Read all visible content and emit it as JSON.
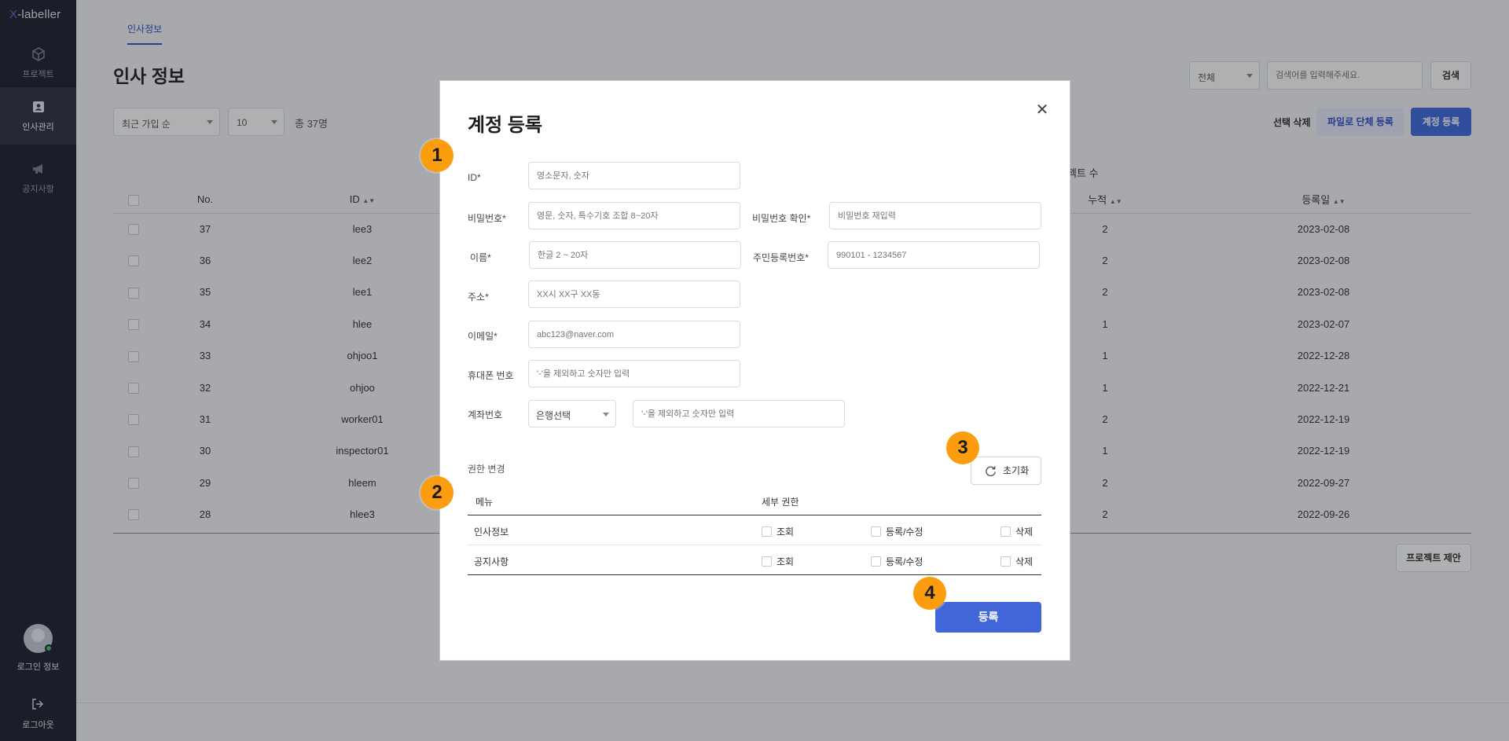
{
  "sidebar": {
    "logo_x": "X",
    "logo_rest": "-labeller",
    "items": [
      {
        "label": "프로젝트",
        "icon": "cube-icon"
      },
      {
        "label": "인사관리",
        "icon": "id-card-icon"
      },
      {
        "label": "공지사항",
        "icon": "megaphone-icon"
      }
    ],
    "login_info": "로그인 정보",
    "logout": "로그아웃"
  },
  "page": {
    "tab": "인사정보",
    "title": "인사 정보",
    "sort_select": "최근 가입 순",
    "page_size": "10",
    "total": "총 37명",
    "filter_select": "전체",
    "search_placeholder": "검색어를 입력해주세요.",
    "search_button": "검색",
    "delete_selected": "선택 삭제",
    "bulk_register": "파일로 단체 등록",
    "register_account": "계정 등록",
    "project_exclude": "프로젝트 제안",
    "project_count_head": "젝트 수"
  },
  "table": {
    "headers": {
      "no": "No.",
      "id": "ID",
      "cumulative": "누적",
      "registered": "등록일"
    },
    "rows": [
      {
        "no": "37",
        "id": "lee3",
        "cum": "2",
        "date": "2023-02-08"
      },
      {
        "no": "36",
        "id": "lee2",
        "cum": "2",
        "date": "2023-02-08"
      },
      {
        "no": "35",
        "id": "lee1",
        "cum": "2",
        "date": "2023-02-08"
      },
      {
        "no": "34",
        "id": "hlee",
        "cum": "1",
        "date": "2023-02-07"
      },
      {
        "no": "33",
        "id": "ohjoo1",
        "cum": "1",
        "date": "2022-12-28"
      },
      {
        "no": "32",
        "id": "ohjoo",
        "cum": "1",
        "date": "2022-12-21"
      },
      {
        "no": "31",
        "id": "worker01",
        "cum": "2",
        "date": "2022-12-19"
      },
      {
        "no": "30",
        "id": "inspector01",
        "cum": "1",
        "date": "2022-12-19"
      },
      {
        "no": "29",
        "id": "hleem",
        "cum": "2",
        "date": "2022-09-27"
      },
      {
        "no": "28",
        "id": "hlee3",
        "cum": "2",
        "date": "2022-09-26"
      }
    ]
  },
  "modal": {
    "title": "계정 등록",
    "fields": {
      "id_label": "ID*",
      "id_placeholder": "영소문자, 숫자",
      "pw_label": "비밀번호*",
      "pw_placeholder": "영문, 숫자, 특수기호 조합 8~20자",
      "pw_confirm_label": "비밀번호 확인*",
      "pw_confirm_placeholder": "비밀번호 재입력",
      "name_label": "이름*",
      "name_placeholder": "한글 2 ~ 20자",
      "rrn_label": "주민등록번호*",
      "rrn_placeholder": "990101 - 1234567",
      "address_label": "주소*",
      "address_placeholder": "XX시 XX구 XX동",
      "email_label": "이메일*",
      "email_placeholder": "abc123@naver.com",
      "phone_label": "휴대폰 번호",
      "phone_placeholder": "'-'을 제외하고 숫자만 입력",
      "account_label": "계좌번호",
      "bank_select": "은행선택",
      "account_placeholder": "'-'을 제외하고 숫자만 입력"
    },
    "permission": {
      "label": "권한 변경",
      "reset": "초기화",
      "head_menu": "메뉴",
      "head_detail": "세부 권한",
      "rows": [
        {
          "menu": "인사정보",
          "view": "조회",
          "edit": "등록/수정",
          "delete": "삭제"
        },
        {
          "menu": "공지사항",
          "view": "조회",
          "edit": "등록/수정",
          "delete": "삭제"
        }
      ]
    },
    "submit": "등록"
  },
  "markers": [
    "1",
    "2",
    "3",
    "4"
  ],
  "colors": {
    "primary": "#4066d8",
    "marker": "#fb9d0e",
    "sidebar": "#1f2230"
  }
}
